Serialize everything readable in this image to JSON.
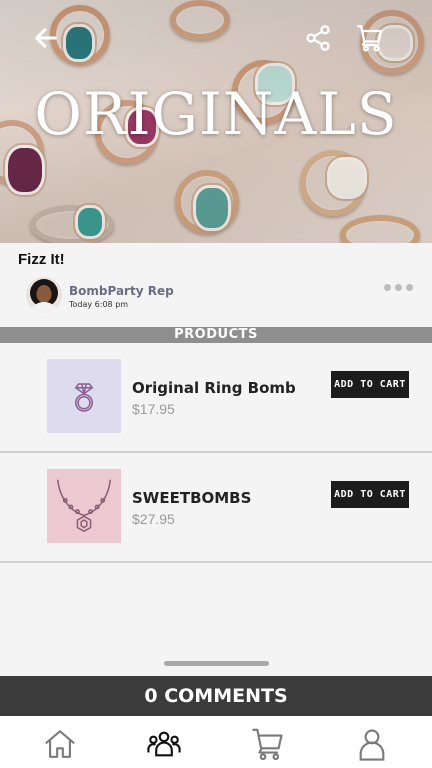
{
  "hero": {
    "title": "ORIGINALS",
    "back_icon": "arrow-left-icon",
    "share_icon": "share-icon",
    "cart_icon": "shopping-cart-icon"
  },
  "post": {
    "title": "Fizz It!",
    "author": "BombParty Rep",
    "time": "Today 6:08 pm",
    "more_icon": "more-horizontal-icon"
  },
  "products_header": "PRODUCTS",
  "products": [
    {
      "name": "Original Ring Bomb",
      "price": "$17.95",
      "button_label": "ADD TO CART",
      "thumb_icon": "ring-icon",
      "thumb_color": "#dedbee",
      "icon_color": "#8a5e92"
    },
    {
      "name": "SWEETBOMBS",
      "price": "$27.95",
      "button_label": "ADD TO CART",
      "thumb_icon": "necklace-icon",
      "thumb_color": "#ecc9d0",
      "icon_color": "#8a5e74"
    }
  ],
  "comments_label": "0 COMMENTS",
  "tabs": [
    {
      "name": "home",
      "icon": "home-icon"
    },
    {
      "name": "community",
      "icon": "group-icon"
    },
    {
      "name": "cart",
      "icon": "shopping-cart-icon"
    },
    {
      "name": "profile",
      "icon": "user-icon"
    }
  ],
  "colors": {
    "accent_dark": "#1c1c1c",
    "products_bar": "#8e8e8e",
    "comments_bar": "#3b3b3b",
    "author_text": "#6c6c80"
  }
}
